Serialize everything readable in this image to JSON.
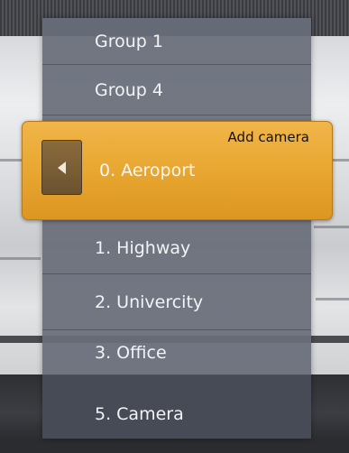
{
  "menu": {
    "groups": [
      {
        "label": "Group 1"
      },
      {
        "label": "Group 4"
      }
    ],
    "selected": {
      "action_label": "Add camera",
      "label": "0. Aeroport"
    },
    "cameras": [
      {
        "label": "1. Highway"
      },
      {
        "label": "2. Univercity"
      },
      {
        "label": "3. Office"
      },
      {
        "label": "5. Camera"
      }
    ]
  },
  "colors": {
    "panel": "#686e7a",
    "highlight": "#e8a730",
    "text": "#f2f3f5"
  },
  "icons": {
    "back": "triangle-left-icon"
  }
}
